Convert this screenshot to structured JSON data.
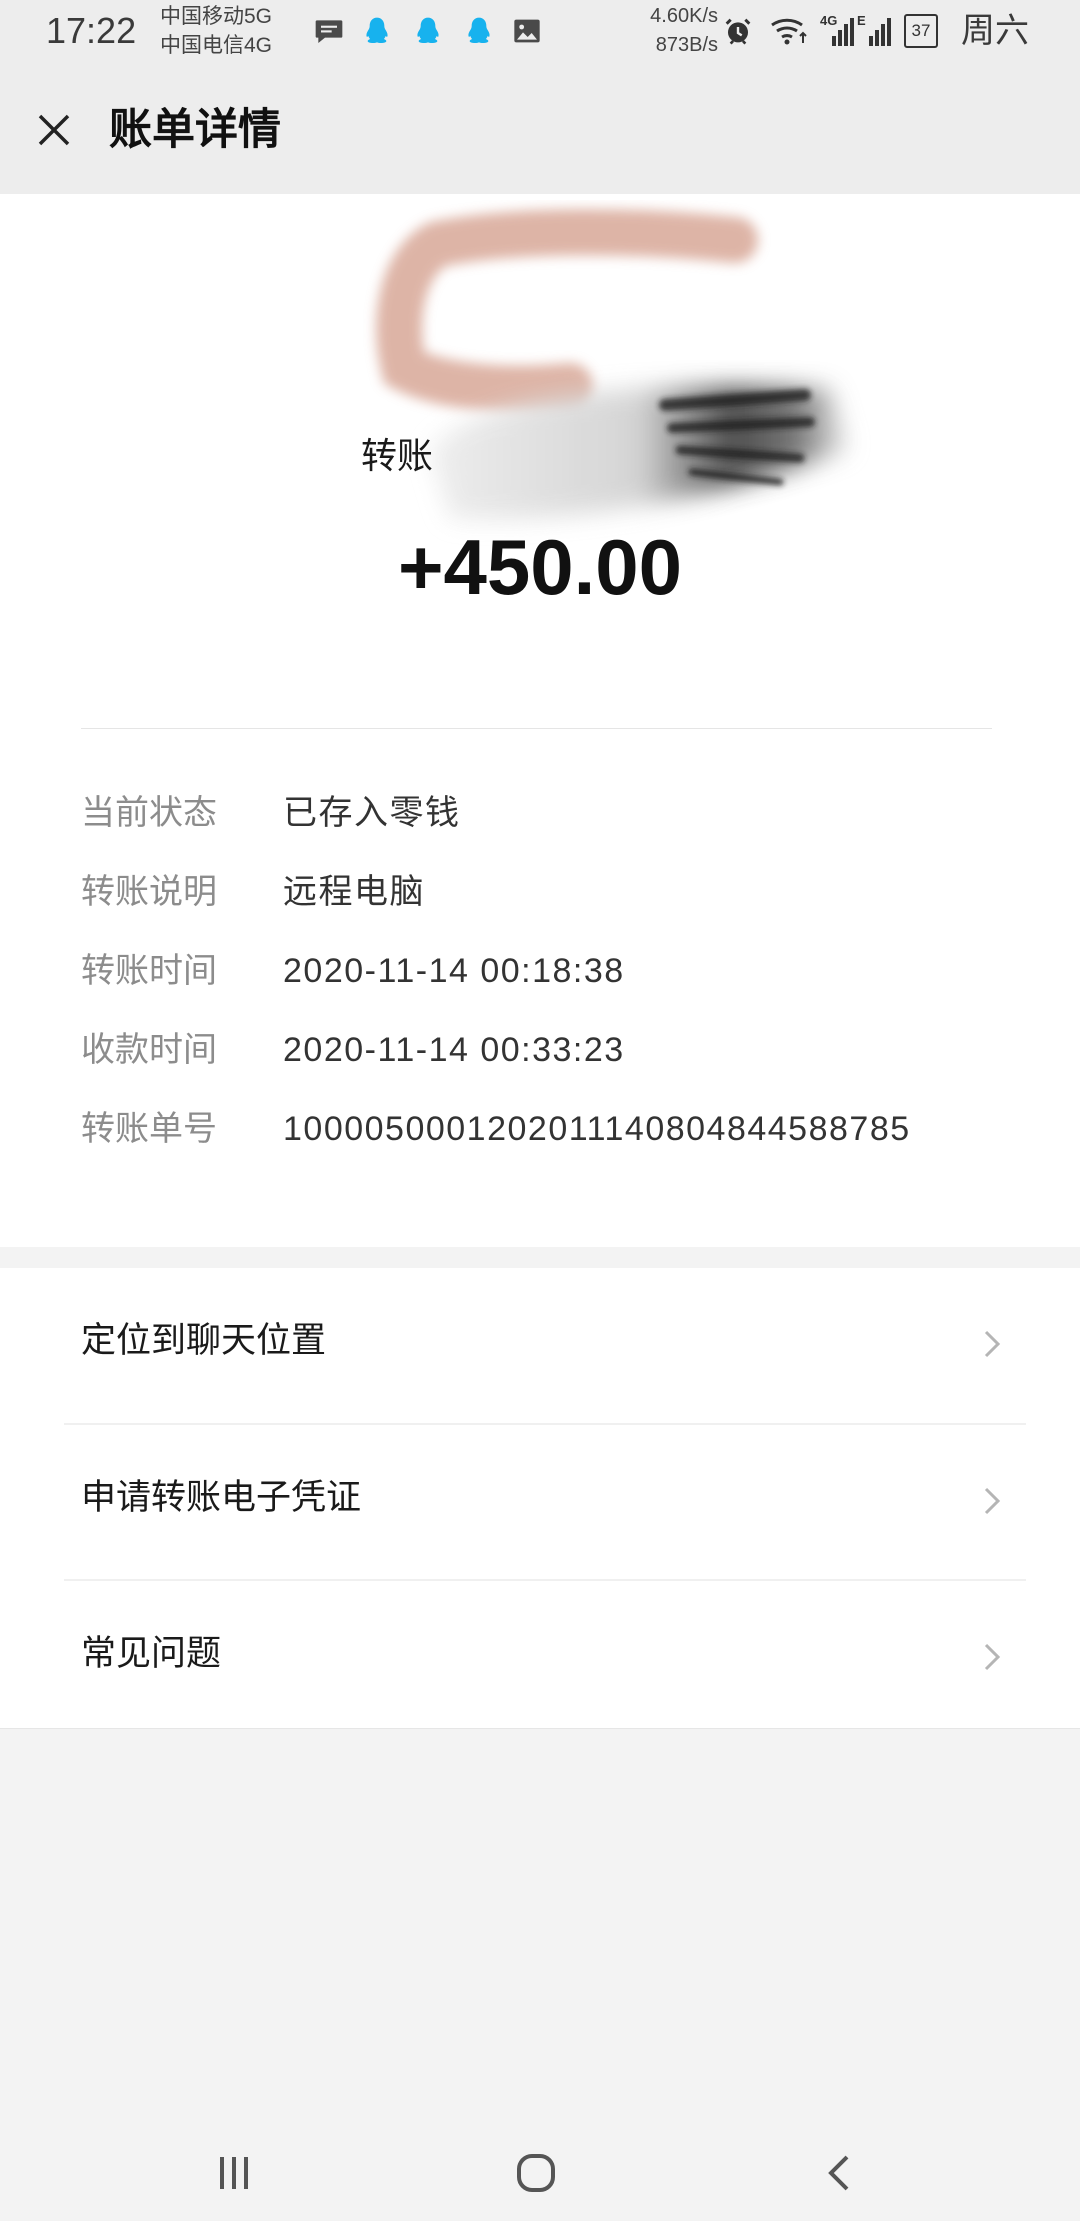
{
  "status_bar": {
    "time": "17:22",
    "carrier_1": "中国移动5G",
    "carrier_2": "中国电信4G",
    "notification_icons": [
      "message-icon",
      "qq-icon",
      "qq-icon",
      "qq-icon",
      "image-icon"
    ],
    "net_speed_line_1": "4.60K/s",
    "net_speed_line_2": "873B/s",
    "signal_1_label": "4G",
    "signal_2_label": "E",
    "battery_level": "37",
    "weekday": "周六"
  },
  "header": {
    "close_icon": "close-icon",
    "title": "账单详情"
  },
  "summary": {
    "type_label": "转账",
    "amount": "+450.00"
  },
  "details": [
    {
      "label": "当前状态",
      "value": "已存入零钱"
    },
    {
      "label": "转账说明",
      "value": "远程电脑"
    },
    {
      "label": "转账时间",
      "value": "2020-11-14 00:18:38"
    },
    {
      "label": "收款时间",
      "value": "2020-11-14 00:33:23"
    },
    {
      "label": "转账单号",
      "value": "1000050001202011140804844588785"
    }
  ],
  "actions": [
    {
      "label": "定位到聊天位置",
      "icon": "chevron-right-icon"
    },
    {
      "label": "申请转账电子凭证",
      "icon": "chevron-right-icon"
    },
    {
      "label": "常见问题",
      "icon": "chevron-right-icon"
    }
  ],
  "nav_bar": {
    "icons": [
      "recent-apps-icon",
      "home-icon",
      "back-icon"
    ]
  },
  "colors": {
    "header_bg": "#ededed",
    "page_bg": "#f3f3f3",
    "card_bg": "#ffffff",
    "label_gray": "#8c8c8c",
    "text_dark": "#1a1a1a",
    "qq_blue": "#17b2ee"
  }
}
